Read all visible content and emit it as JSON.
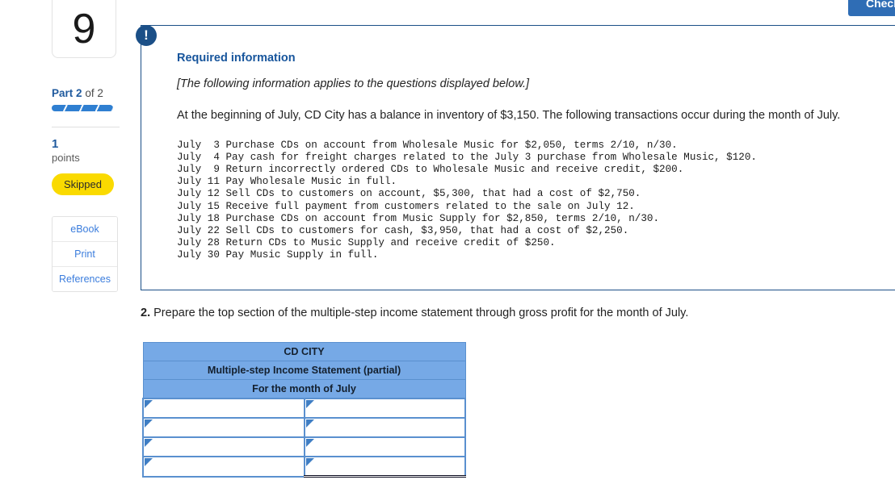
{
  "toolbar": {
    "check_label": "Check"
  },
  "left_rail": {
    "question_number": "9",
    "part_prefix": "Part",
    "part_current": "2",
    "part_suffix": "of 2",
    "part_full": "Part 2 of 2",
    "points_value": "1",
    "points_label": "points",
    "status_badge": "Skipped",
    "buttons": [
      {
        "label": "eBook"
      },
      {
        "label": "Print"
      },
      {
        "label": "References"
      }
    ]
  },
  "info_callout": {
    "badge_glyph": "!",
    "title": "Required information",
    "italic_note": "[The following information applies to the questions displayed below.]",
    "intro": "At the beginning of July, CD City has a balance in inventory of $3,150. The following transactions occur during the month of July.",
    "transactions": "July  3 Purchase CDs on account from Wholesale Music for $2,050, terms 2/10, n/30.\nJuly  4 Pay cash for freight charges related to the July 3 purchase from Wholesale Music, $120.\nJuly  9 Return incorrectly ordered CDs to Wholesale Music and receive credit, $200.\nJuly 11 Pay Wholesale Music in full.\nJuly 12 Sell CDs to customers on account, $5,300, that had a cost of $2,750.\nJuly 15 Receive full payment from customers related to the sale on July 12.\nJuly 18 Purchase CDs on account from Music Supply for $2,850, terms 2/10, n/30.\nJuly 22 Sell CDs to customers for cash, $3,950, that had a cost of $2,250.\nJuly 28 Return CDs to Music Supply and receive credit of $250.\nJuly 30 Pay Music Supply in full."
  },
  "question": {
    "number": "2.",
    "text": "Prepare the top section of the multiple-step income statement through gross profit for the month of July."
  },
  "worksheet": {
    "header_rows": [
      "CD CITY",
      "Multiple-step Income Statement (partial)",
      "For the month of July"
    ],
    "rows": [
      {
        "label_value": "",
        "amount_value": "",
        "total": false
      },
      {
        "label_value": "",
        "amount_value": "",
        "total": false
      },
      {
        "label_value": "",
        "amount_value": "",
        "total": false
      },
      {
        "label_value": "",
        "amount_value": "",
        "total": true
      }
    ]
  },
  "colors": {
    "accent_blue": "#2f6db5",
    "callout_border": "#1b4f87",
    "callout_title": "#17559c",
    "table_header_bg": "#76a9e6",
    "table_border": "#5a90cf",
    "skipped_yellow": "#fada00",
    "link_blue": "#3b7ddd"
  }
}
